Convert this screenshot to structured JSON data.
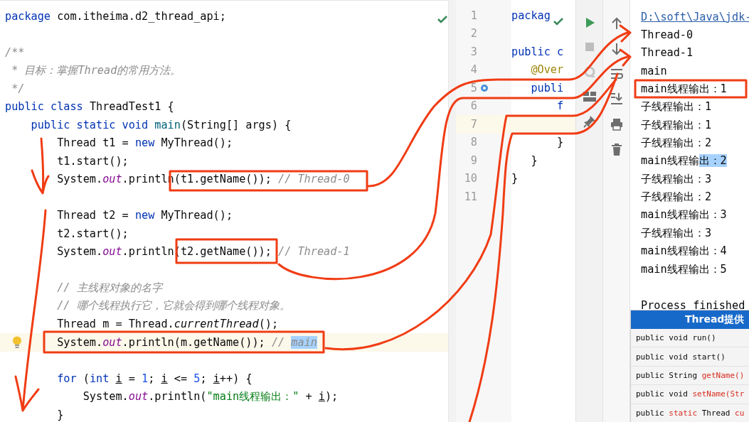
{
  "left_editor": {
    "lines": [
      {
        "current": false,
        "segments": [
          {
            "text": "package",
            "kind": "keyword"
          },
          {
            "text": " com.itheima.d2_thread_api;",
            "kind": "plain"
          }
        ]
      },
      {
        "current": false
      },
      {
        "current": false,
        "segments": [
          {
            "text": "/**",
            "kind": "comment"
          }
        ]
      },
      {
        "current": false,
        "segments": [
          {
            "text": " * 目标：掌握Thread的常用方法。",
            "kind": "comment"
          }
        ]
      },
      {
        "current": false,
        "segments": [
          {
            "text": " */",
            "kind": "comment"
          }
        ]
      },
      {
        "current": false,
        "segments": [
          {
            "text": "public class",
            "kind": "keyword"
          },
          {
            "text": " ThreadTest1 {",
            "kind": "plain"
          }
        ]
      },
      {
        "current": false,
        "segments": [
          {
            "text": "    public static void",
            "kind": "keyword"
          },
          {
            "text": " main",
            "kind": "declaration"
          },
          {
            "text": "(String[] args) {",
            "kind": "plain"
          }
        ]
      },
      {
        "current": false,
        "segments": [
          {
            "text": "        Thread t1 = ",
            "kind": "plain"
          },
          {
            "text": "new",
            "kind": "keyword"
          },
          {
            "text": " MyThread();",
            "kind": "plain"
          }
        ]
      },
      {
        "current": false,
        "segments": [
          {
            "text": "        t1.start();",
            "kind": "plain"
          }
        ]
      },
      {
        "current": false,
        "segments": [
          {
            "text": "        System.",
            "kind": "plain"
          },
          {
            "text": "out",
            "kind": "field"
          },
          {
            "text": ".println(t1.getName()); ",
            "kind": "plain"
          },
          {
            "text": "// Thread-0",
            "kind": "comment"
          }
        ]
      },
      {
        "current": false
      },
      {
        "current": false,
        "segments": [
          {
            "text": "        Thread t2 = ",
            "kind": "plain"
          },
          {
            "text": "new",
            "kind": "keyword"
          },
          {
            "text": " MyThread();",
            "kind": "plain"
          }
        ]
      },
      {
        "current": false,
        "segments": [
          {
            "text": "        t2.start();",
            "kind": "plain"
          }
        ]
      },
      {
        "current": false,
        "segments": [
          {
            "text": "        System.",
            "kind": "plain"
          },
          {
            "text": "out",
            "kind": "field"
          },
          {
            "text": ".println(t2.getName()); ",
            "kind": "plain"
          },
          {
            "text": "// Thread-1",
            "kind": "comment"
          }
        ]
      },
      {
        "current": false
      },
      {
        "current": false,
        "segments": [
          {
            "text": "        // 主线程对象的名字",
            "kind": "comment"
          }
        ]
      },
      {
        "current": false,
        "segments": [
          {
            "text": "        // 哪个线程执行它，它就会得到哪个线程对象。",
            "kind": "comment"
          }
        ]
      },
      {
        "current": false,
        "segments": [
          {
            "text": "        Thread m = Thread.",
            "kind": "plain"
          },
          {
            "text": "currentThread",
            "kind": "static-call"
          },
          {
            "text": "();",
            "kind": "plain"
          }
        ]
      },
      {
        "current": true,
        "segments": [
          {
            "text": "        System.",
            "kind": "plain"
          },
          {
            "text": "out",
            "kind": "field"
          },
          {
            "text": ".println(m.getName()); ",
            "kind": "plain"
          },
          {
            "text": "// ",
            "kind": "comment"
          },
          {
            "text": "main",
            "kind": "selected-comment"
          }
        ]
      },
      {
        "current": false
      },
      {
        "current": false,
        "segments": [
          {
            "text": "        for",
            "kind": "keyword"
          },
          {
            "text": " (",
            "kind": "plain"
          },
          {
            "text": "int ",
            "kind": "keyword"
          },
          {
            "text": "i",
            "kind": "variable"
          },
          {
            "text": " = ",
            "kind": "plain"
          },
          {
            "text": "1",
            "kind": "number"
          },
          {
            "text": "; ",
            "kind": "plain"
          },
          {
            "text": "i",
            "kind": "variable"
          },
          {
            "text": " <= ",
            "kind": "plain"
          },
          {
            "text": "5",
            "kind": "number"
          },
          {
            "text": "; ",
            "kind": "plain"
          },
          {
            "text": "i",
            "kind": "variable"
          },
          {
            "text": "++) {",
            "kind": "plain"
          }
        ]
      },
      {
        "current": false,
        "segments": [
          {
            "text": "            System.",
            "kind": "plain"
          },
          {
            "text": "out",
            "kind": "field"
          },
          {
            "text": ".println(",
            "kind": "plain"
          },
          {
            "text": "\"main线程输出：\"",
            "kind": "string"
          },
          {
            "text": " + ",
            "kind": "plain"
          },
          {
            "text": "i",
            "kind": "variable"
          },
          {
            "text": ");",
            "kind": "plain"
          }
        ]
      },
      {
        "current": false,
        "segments": [
          {
            "text": "        }",
            "kind": "plain"
          }
        ]
      }
    ]
  },
  "middle_editor": {
    "lines": [
      {
        "number": "1",
        "current": false,
        "segments": [
          {
            "text": "packag",
            "kind": "keyword"
          }
        ]
      },
      {
        "number": "2",
        "current": false
      },
      {
        "number": "3",
        "current": false,
        "segments": [
          {
            "text": "public c",
            "kind": "keyword"
          }
        ]
      },
      {
        "number": "4",
        "current": false,
        "segments": [
          {
            "text": "   @Over",
            "kind": "annotation"
          }
        ]
      },
      {
        "number": "5",
        "current": false,
        "segments": [
          {
            "text": "   publi",
            "kind": "keyword"
          }
        ]
      },
      {
        "number": "6",
        "current": false,
        "segments": [
          {
            "text": "       f",
            "kind": "keyword"
          }
        ]
      },
      {
        "number": "7",
        "current": true
      },
      {
        "number": "8",
        "current": false,
        "segments": [
          {
            "text": "       }",
            "kind": "plain"
          }
        ]
      },
      {
        "number": "9",
        "current": false,
        "segments": [
          {
            "text": "   }",
            "kind": "plain"
          }
        ]
      },
      {
        "number": "10",
        "current": false,
        "segments": [
          {
            "text": "}",
            "kind": "plain"
          }
        ]
      },
      {
        "number": "11",
        "current": false
      }
    ]
  },
  "console": {
    "lines": [
      {
        "segments": [
          {
            "text": "D:\\soft\\Java\\jdk-",
            "kind": "link"
          }
        ]
      },
      {
        "segments": [
          {
            "text": "Thread-0",
            "kind": "plain"
          }
        ]
      },
      {
        "segments": [
          {
            "text": "Thread-1",
            "kind": "plain"
          }
        ]
      },
      {
        "segments": [
          {
            "text": "main",
            "kind": "plain"
          }
        ]
      },
      {
        "segments": [
          {
            "text": "main线程输出：1",
            "kind": "plain"
          }
        ]
      },
      {
        "segments": [
          {
            "text": "子线程输出：1",
            "kind": "plain"
          }
        ]
      },
      {
        "segments": [
          {
            "text": "子线程输出：1",
            "kind": "plain"
          }
        ]
      },
      {
        "segments": [
          {
            "text": "子线程输出：2",
            "kind": "plain"
          }
        ]
      },
      {
        "segments": [
          {
            "text": "main线程输",
            "kind": "plain"
          },
          {
            "text": "出：2",
            "kind": "selected"
          }
        ]
      },
      {
        "segments": [
          {
            "text": "子线程输出：3",
            "kind": "plain"
          }
        ]
      },
      {
        "segments": [
          {
            "text": "子线程输出：2",
            "kind": "plain"
          }
        ]
      },
      {
        "segments": [
          {
            "text": "main线程输出：3",
            "kind": "plain"
          }
        ]
      },
      {
        "segments": [
          {
            "text": "子线程输出：3",
            "kind": "plain"
          }
        ]
      },
      {
        "segments": [
          {
            "text": "main线程输出：4",
            "kind": "plain"
          }
        ]
      },
      {
        "segments": [
          {
            "text": "main线程输出：5",
            "kind": "plain"
          }
        ]
      },
      {
        "segments": [
          {
            "text": "Process finished",
            "kind": "plain"
          }
        ]
      }
    ]
  },
  "method_table": {
    "title": "Thread提供",
    "rows": [
      {
        "segments": [
          {
            "text": "public void run()",
            "kind": "plain"
          }
        ]
      },
      {
        "segments": [
          {
            "text": "public void start()",
            "kind": "plain"
          }
        ]
      },
      {
        "segments": [
          {
            "text": "public String ",
            "kind": "plain"
          },
          {
            "text": "getName()",
            "kind": "highlight"
          }
        ]
      },
      {
        "segments": [
          {
            "text": "public void ",
            "kind": "plain"
          },
          {
            "text": "setName(Str",
            "kind": "highlight"
          }
        ]
      },
      {
        "segments": [
          {
            "text": "public ",
            "kind": "plain"
          },
          {
            "text": "static",
            "kind": "highlight"
          },
          {
            "text": " Thread ",
            "kind": "plain"
          },
          {
            "text": "cu",
            "kind": "highlight"
          }
        ]
      }
    ]
  }
}
